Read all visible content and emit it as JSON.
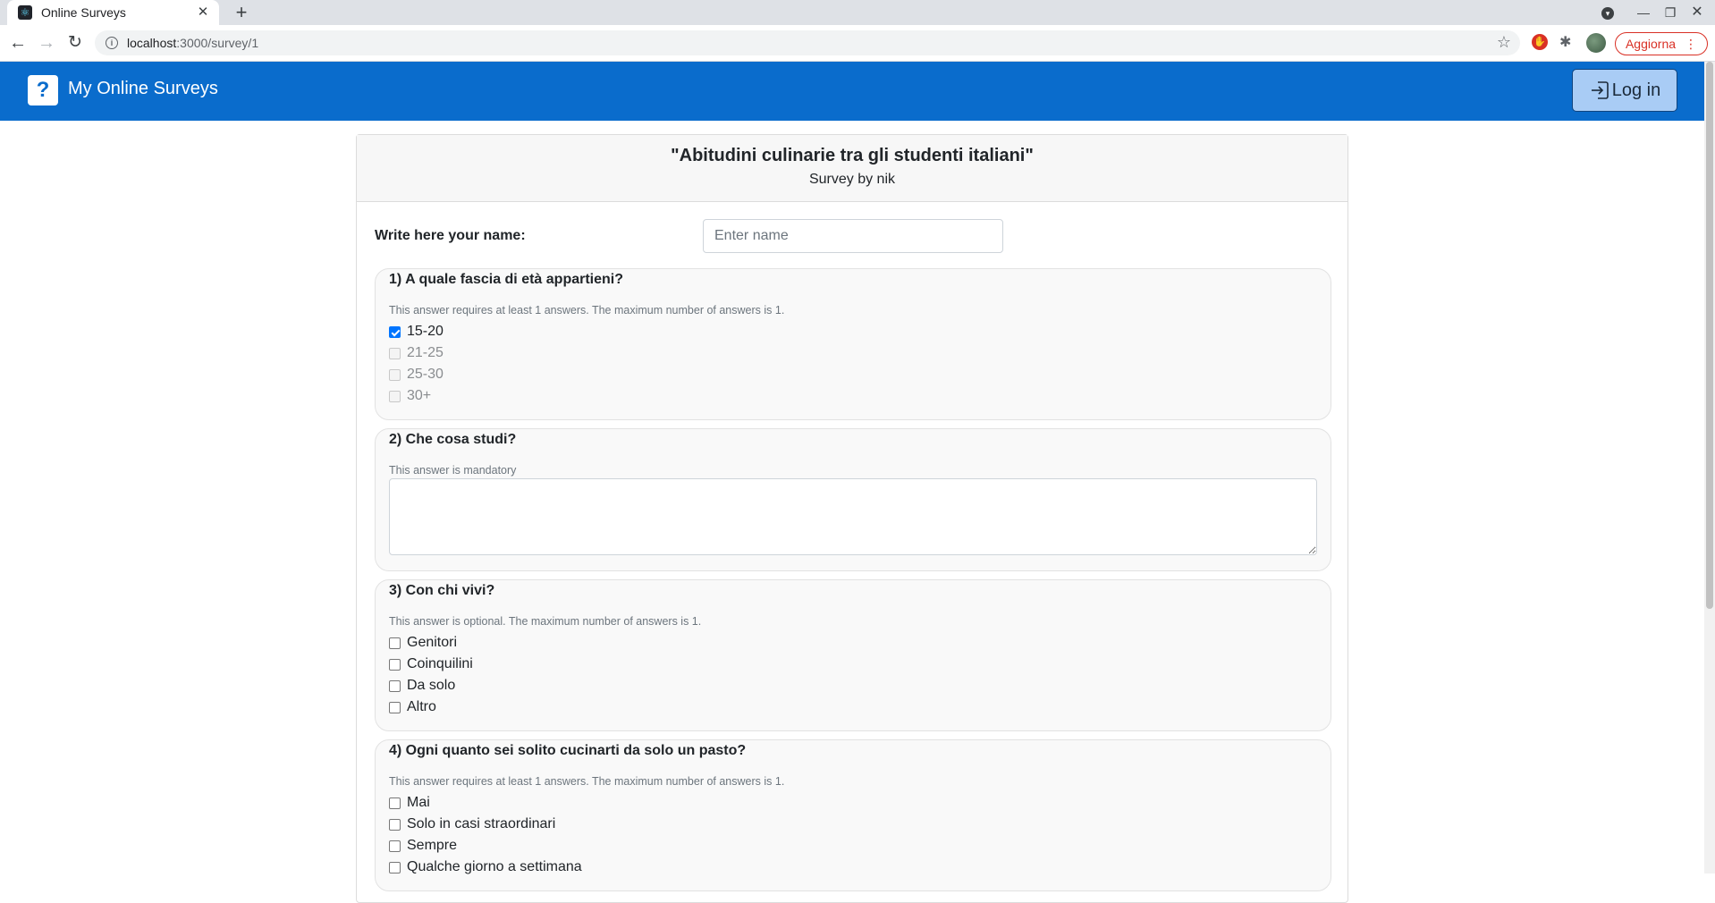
{
  "browser": {
    "tab_title": "Online Surveys",
    "url_host": "localhost",
    "url_path": ":3000/survey/1",
    "update_label": "Aggiorna"
  },
  "navbar": {
    "brand": "My Online Surveys",
    "brand_icon": "?",
    "login_label": "Log in",
    "color": "#0a6ccc"
  },
  "survey": {
    "title": "\"Abitudini culinarie tra gli studenti italiani\"",
    "author": "Survey by nik",
    "name_label": "Write here your name:",
    "name_placeholder": "Enter name",
    "name_value": "",
    "questions": [
      {
        "title": "1) A quale fascia di età appartieni?",
        "note": "This answer requires at least 1 answers. The maximum number of answers is 1.",
        "options": [
          {
            "label": "15-20",
            "checked": true,
            "disabled": false
          },
          {
            "label": "21-25",
            "checked": false,
            "disabled": true
          },
          {
            "label": "25-30",
            "checked": false,
            "disabled": true
          },
          {
            "label": "30+",
            "checked": false,
            "disabled": true
          }
        ]
      },
      {
        "title": "2) Che cosa studi?",
        "note": "This answer is mandatory",
        "answer": ""
      },
      {
        "title": "3) Con chi vivi?",
        "note": "This answer is optional. The maximum number of answers is 1.",
        "options": [
          {
            "label": "Genitori",
            "checked": false,
            "disabled": false
          },
          {
            "label": "Coinquilini",
            "checked": false,
            "disabled": false
          },
          {
            "label": "Da solo",
            "checked": false,
            "disabled": false
          },
          {
            "label": "Altro",
            "checked": false,
            "disabled": false
          }
        ]
      },
      {
        "title": "4) Ogni quanto sei solito cucinarti da solo un pasto?",
        "note": "This answer requires at least 1 answers. The maximum number of answers is 1.",
        "options": [
          {
            "label": "Mai",
            "checked": false,
            "disabled": false
          },
          {
            "label": "Solo in casi straordinari",
            "checked": false,
            "disabled": false
          },
          {
            "label": "Sempre",
            "checked": false,
            "disabled": false
          },
          {
            "label": "Qualche giorno a settimana",
            "checked": false,
            "disabled": false
          }
        ]
      }
    ]
  }
}
